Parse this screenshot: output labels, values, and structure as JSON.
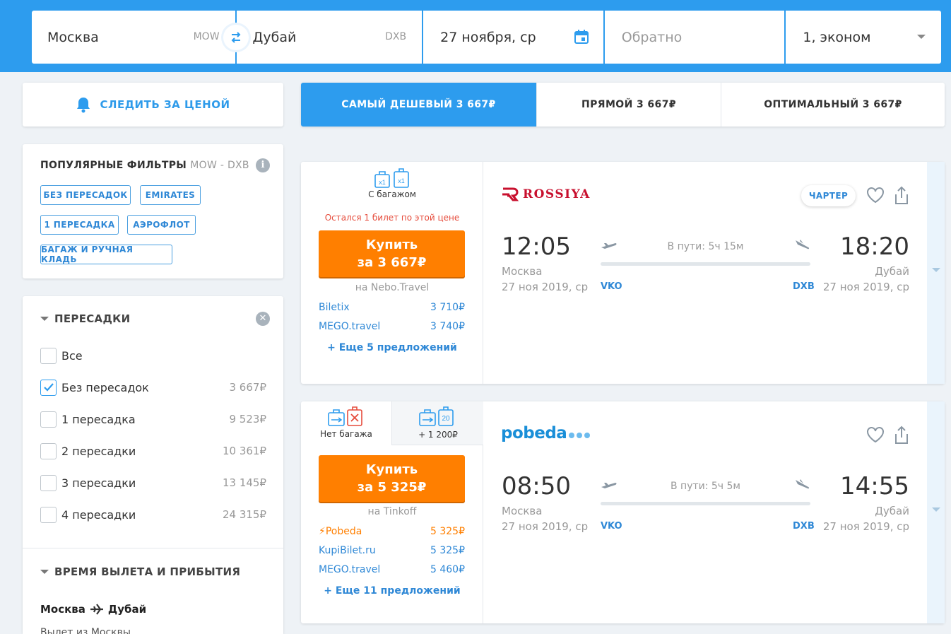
{
  "search": {
    "origin_city": "Москва",
    "origin_code": "MOW",
    "dest_city": "Дубай",
    "dest_code": "DXB",
    "date": "27 ноября, ср",
    "return_placeholder": "Обратно",
    "passengers": "1, эконом"
  },
  "track_price": {
    "label": "СЛЕДИТЬ ЗА ЦЕНОЙ"
  },
  "popular_filters": {
    "title": "ПОПУЛЯРНЫЕ ФИЛЬТРЫ",
    "route": "MOW - DXB",
    "chips": [
      "БЕЗ ПЕРЕСАДОК",
      "EMIRATES",
      "1 ПЕРЕСАДКА",
      "АЭРОФЛОТ",
      "БАГАЖ И РУЧНАЯ КЛАДЬ"
    ]
  },
  "stops_filter": {
    "title": "ПЕРЕСАДКИ",
    "options": [
      {
        "label": "Все",
        "price": "",
        "checked": false
      },
      {
        "label": "Без пересадок",
        "price": "3 667₽",
        "checked": true
      },
      {
        "label": "1 пересадка",
        "price": "9 523₽",
        "checked": false
      },
      {
        "label": "2 пересадки",
        "price": "10 361₽",
        "checked": false
      },
      {
        "label": "3 пересадки",
        "price": "13 145₽",
        "checked": false
      },
      {
        "label": "4 пересадки",
        "price": "24 315₽",
        "checked": false
      }
    ]
  },
  "time_filter": {
    "title": "ВРЕМЯ ВЫЛЕТА И ПРИБЫТИЯ",
    "route_from": "Москва",
    "route_to": "Дубай",
    "sub": "Вылет из Москвы"
  },
  "tabs": [
    {
      "label": "САМЫЙ ДЕШЕВЫЙ",
      "price": "3 667₽",
      "active": true
    },
    {
      "label": "ПРЯМОЙ",
      "price": "3 667₽",
      "active": false
    },
    {
      "label": "ОПТИМАЛЬНЫЙ",
      "price": "3 667₽",
      "active": false
    }
  ],
  "results": [
    {
      "baggage_label": "С багажом",
      "bag_count": "x1",
      "hand_count": "x1",
      "warning": "Остался 1 билет по этой цене",
      "buy_line1": "Купить",
      "buy_line2": "за 3 667₽",
      "via": "на Nebo.Travel",
      "offers": [
        {
          "agent": "Biletix",
          "price": "3 710₽"
        },
        {
          "agent": "MEGO.travel",
          "price": "3 740₽"
        }
      ],
      "more": "+ Еще 5 предложений",
      "airline": "ROSSIYA",
      "badge": "ЧАРТЕР",
      "dep_time": "12:05",
      "dep_city": "Москва",
      "dep_date": "27 ноя 2019, ср",
      "dep_airport": "VKO",
      "duration": "В пути: 5ч 15м",
      "arr_time": "18:20",
      "arr_city": "Дубай",
      "arr_date": "27 ноя 2019, ср",
      "arr_airport": "DXB"
    },
    {
      "baggage_label": "Нет багажа",
      "baggage_alt_label": "+ 1 200₽",
      "bag_weight": "20",
      "buy_line1": "Купить",
      "buy_line2": "за 5 325₽",
      "via": "на Tinkoff",
      "offers": [
        {
          "agent": "Pobeda",
          "price": "5 325₽",
          "highlight": true
        },
        {
          "agent": "KupiBilet.ru",
          "price": "5 325₽"
        },
        {
          "agent": "MEGO.travel",
          "price": "5 460₽"
        }
      ],
      "more": "+ Еще 11 предложений",
      "airline": "pobeda",
      "dep_time": "08:50",
      "dep_city": "Москва",
      "dep_date": "27 ноя 2019, ср",
      "dep_airport": "VKO",
      "duration": "В пути: 5ч 5м",
      "arr_time": "14:55",
      "arr_city": "Дубай",
      "arr_date": "27 ноя 2019, ср",
      "arr_airport": "DXB"
    }
  ],
  "colors": {
    "brand_blue": "#2d9cee",
    "buy_orange": "#ff7f00",
    "warning_red": "#e64b3b",
    "rossiya_red": "#c8102e"
  },
  "icons": [
    "swap-icon",
    "calendar-icon",
    "bell-icon",
    "info-icon",
    "clear-icon",
    "check-icon",
    "baggage-icon",
    "heart-icon",
    "share-icon",
    "plane-takeoff-icon",
    "plane-landing-icon",
    "chevron-down-icon"
  ]
}
